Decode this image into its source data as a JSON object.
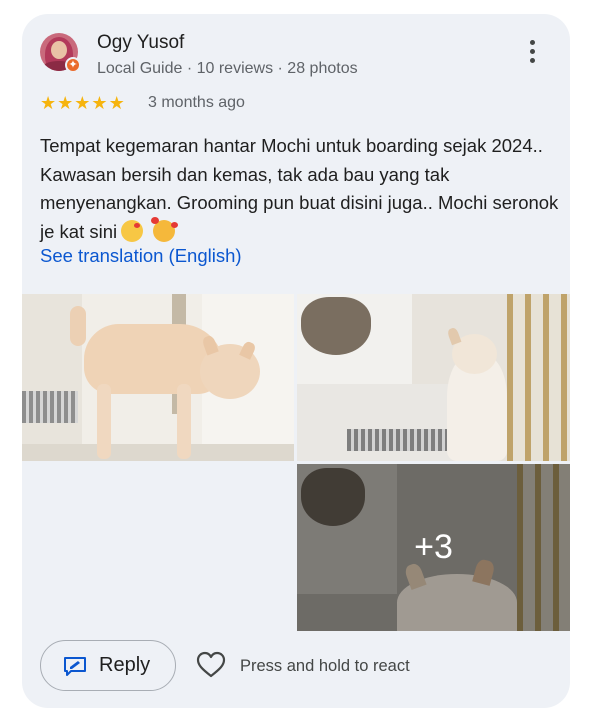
{
  "review": {
    "author_name": "Ogy Yusof",
    "author_meta": "Local Guide · 10 reviews · 28 photos",
    "rating": 5,
    "time": "3 months ago",
    "text": "Tempat kegemaran hantar Mochi untuk boarding sejak 2024.. Kawasan bersih dan kemas, tak ada bau yang tak menyenangkan. Grooming pun buat disini juga.. Mochi seronok je kat sini",
    "translate_link": "See translation (English)"
  },
  "photos": {
    "more_count": "+3"
  },
  "actions": {
    "reply_label": "Reply",
    "react_hint": "Press and hold to react"
  },
  "colors": {
    "card_bg": "#eef1f6",
    "star": "#f6b40e",
    "link": "#0b57d0",
    "guide_badge": "#ea6a2b"
  },
  "icons": [
    "more-vert-icon",
    "star-icon",
    "reply-icon",
    "heart-icon",
    "local-guide-badge-icon"
  ]
}
